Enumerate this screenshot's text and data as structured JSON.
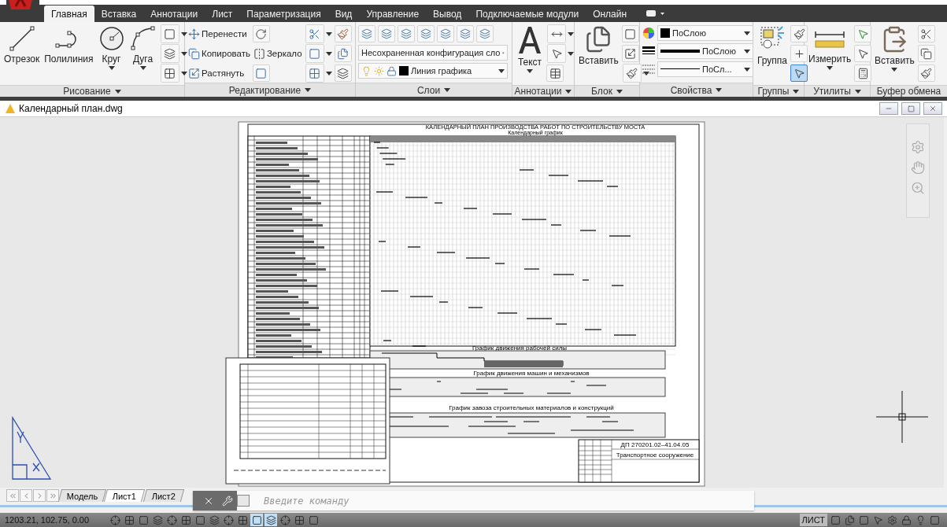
{
  "app_tabs": [
    {
      "label": "Главная",
      "selected": true
    },
    {
      "label": "Вставка",
      "selected": false
    },
    {
      "label": "Аннотации",
      "selected": false
    },
    {
      "label": "Лист",
      "selected": false
    },
    {
      "label": "Параметризация",
      "selected": false
    },
    {
      "label": "Вид",
      "selected": false
    },
    {
      "label": "Управление",
      "selected": false
    },
    {
      "label": "Вывод",
      "selected": false
    },
    {
      "label": "Подключаемые модули",
      "selected": false
    },
    {
      "label": "Онлайн",
      "selected": false
    }
  ],
  "ribbon_panels": [
    {
      "kind": "draw",
      "title": "Рисование",
      "menu": true,
      "tools": [
        {
          "label": "Отрезок",
          "menu": false
        },
        {
          "label": "Полилиния",
          "menu": false
        },
        {
          "label": "Круг",
          "menu": true
        },
        {
          "label": "Дуга",
          "menu": true
        }
      ]
    },
    {
      "kind": "modify",
      "title": "Редактирование",
      "menu": true,
      "tools": [
        {
          "label": "Перенести"
        },
        {
          "label": "Копировать"
        },
        {
          "label": "Растянуть"
        },
        {
          "label": "Зеркало"
        }
      ]
    },
    {
      "kind": "layers",
      "title": "Слои",
      "menu": true,
      "config": "Несохраненная конфигурация сло",
      "layer": "Линия графика"
    },
    {
      "kind": "large",
      "title": "Аннотации",
      "menu": true,
      "tool": {
        "label": "Текст",
        "menu": true
      }
    },
    {
      "kind": "block",
      "title": "Блок",
      "menu": true,
      "tool": {
        "label": "Вставить",
        "menu": false
      }
    },
    {
      "kind": "properties",
      "title": "Свойства",
      "menu": true,
      "color_setting": "ПоСлою",
      "lineweight": "ПоСлою",
      "linetype": "ПоСл..."
    },
    {
      "kind": "groups",
      "title": "Группы",
      "menu": true,
      "tool": {
        "label": "Группа",
        "menu": false
      },
      "selection_on": true
    },
    {
      "kind": "utilities",
      "title": "Утилиты",
      "menu": true,
      "tool": {
        "label": "Измерить",
        "menu": true
      }
    },
    {
      "kind": "clipboard",
      "title": "Буфер обмена",
      "menu": false,
      "tool": {
        "label": "Вставить",
        "menu": true
      }
    }
  ],
  "document": {
    "title": "Календарный план.dwg"
  },
  "sheet": {
    "title": "КАЛЕНДАРНЫЙ ПЛАН ПРОИЗВОДСТВА РАБОТ ПО СТРОИТЕЛЬСТВУ МОСТА",
    "subtitle": "Календарный график",
    "chart_titles": [
      "График движения рабочей силы",
      "График движения машин и механизмов",
      "График завоза строительных материалов и конструкций"
    ],
    "stamp_code": "ДП 270201.02–41.04.05",
    "stamp_title": "Транспортное сооружение"
  },
  "layout_tabs": [
    {
      "label": "Модель",
      "selected": false
    },
    {
      "label": "Лист1",
      "selected": true
    },
    {
      "label": "Лист2",
      "selected": false
    }
  ],
  "command_line": {
    "placeholder": "Введите команду"
  },
  "status_bar": {
    "coordinates": "1203.21, 102.75, 0.00",
    "space": "ЛИСТ",
    "toggles": [
      {
        "on": false
      },
      {
        "on": false
      },
      {
        "on": false
      },
      {
        "on": false
      },
      {
        "on": false
      },
      {
        "on": false
      },
      {
        "on": false
      },
      {
        "on": false
      },
      {
        "on": false
      },
      {
        "on": false
      },
      {
        "on": true
      },
      {
        "on": true
      },
      {
        "on": false
      },
      {
        "on": false
      },
      {
        "on": false
      }
    ]
  }
}
